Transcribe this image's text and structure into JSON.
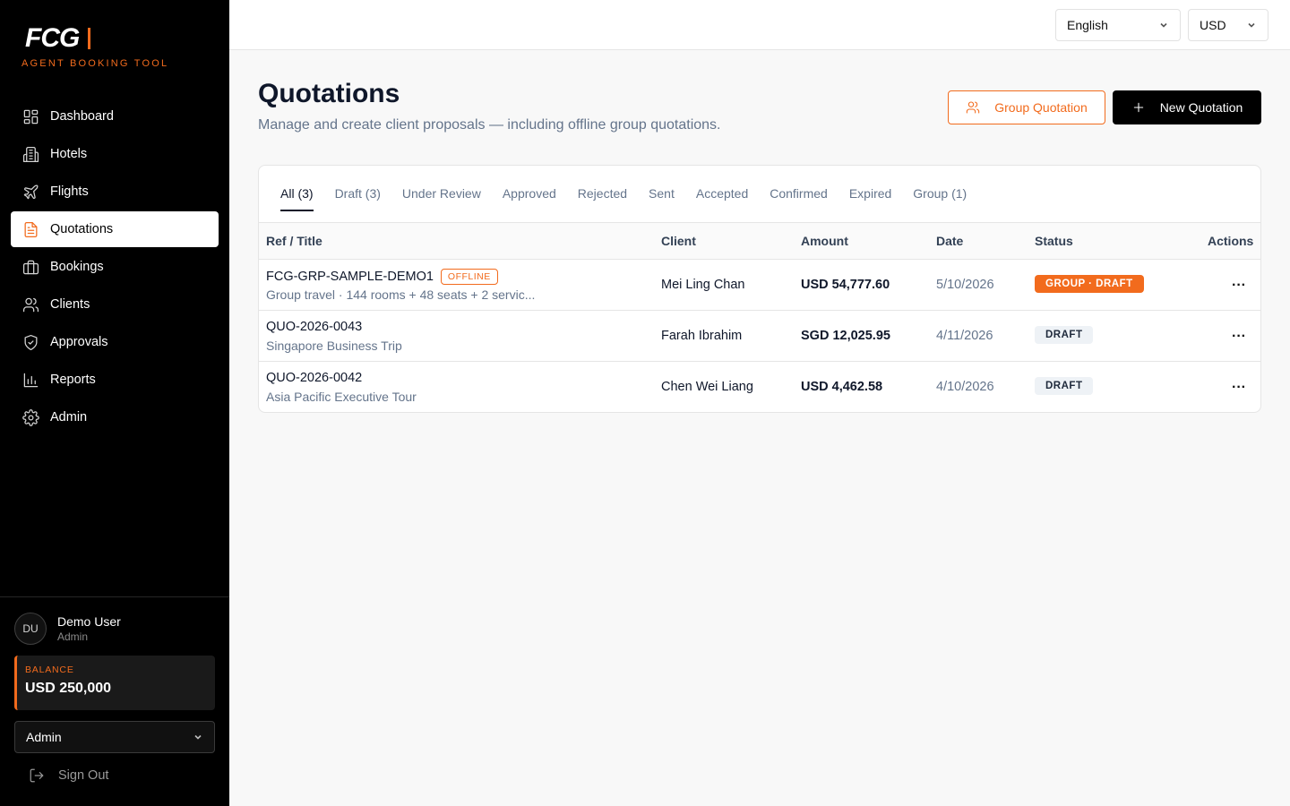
{
  "brand": {
    "logo_text": "FCG",
    "subtitle": "AGENT BOOKING TOOL",
    "accent": "#f26b1d"
  },
  "sidebar": {
    "items": [
      {
        "label": "Dashboard",
        "icon": "dashboard-icon"
      },
      {
        "label": "Hotels",
        "icon": "building-icon"
      },
      {
        "label": "Flights",
        "icon": "plane-icon"
      },
      {
        "label": "Quotations",
        "icon": "document-icon",
        "active": true
      },
      {
        "label": "Bookings",
        "icon": "briefcase-icon"
      },
      {
        "label": "Clients",
        "icon": "users-icon"
      },
      {
        "label": "Approvals",
        "icon": "shield-check-icon"
      },
      {
        "label": "Reports",
        "icon": "bar-chart-icon"
      },
      {
        "label": "Admin",
        "icon": "gear-icon"
      }
    ],
    "user": {
      "initials": "DU",
      "name": "Demo User",
      "role": "Admin"
    },
    "balance": {
      "label": "BALANCE",
      "value": "USD 250,000"
    },
    "role_select": "Admin",
    "sign_out": "Sign Out"
  },
  "topbar": {
    "language": "English",
    "currency": "USD"
  },
  "header": {
    "title": "Quotations",
    "subtitle": "Manage and create client proposals — including offline group quotations.",
    "group_button": "Group Quotation",
    "new_button": "New Quotation"
  },
  "tabs": [
    {
      "label": "All (3)",
      "active": true
    },
    {
      "label": "Draft (3)"
    },
    {
      "label": "Under Review"
    },
    {
      "label": "Approved"
    },
    {
      "label": "Rejected"
    },
    {
      "label": "Sent"
    },
    {
      "label": "Accepted"
    },
    {
      "label": "Confirmed"
    },
    {
      "label": "Expired"
    },
    {
      "label": "Group (1)"
    }
  ],
  "table": {
    "headers": {
      "ref": "Ref / Title",
      "client": "Client",
      "amount": "Amount",
      "date": "Date",
      "status": "Status",
      "actions": "Actions"
    },
    "rows": [
      {
        "ref": "FCG-GRP-SAMPLE-DEMO1",
        "badge": "OFFLINE",
        "title": "Group travel · 144 rooms + 48 seats + 2 servic...",
        "client": "Mei Ling Chan",
        "amount": "USD 54,777.60",
        "date": "5/10/2026",
        "status": "GROUP · DRAFT",
        "actions": "···"
      },
      {
        "ref": "QUO-2026-0043",
        "title": "Singapore Business Trip",
        "client": "Farah Ibrahim",
        "amount": "SGD 12,025.95",
        "date": "4/11/2026",
        "status": "DRAFT",
        "actions": "···"
      },
      {
        "ref": "QUO-2026-0042",
        "title": "Asia Pacific Executive Tour",
        "client": "Chen Wei Liang",
        "amount": "USD 4,462.58",
        "date": "4/10/2026",
        "status": "DRAFT",
        "actions": "···"
      }
    ]
  }
}
